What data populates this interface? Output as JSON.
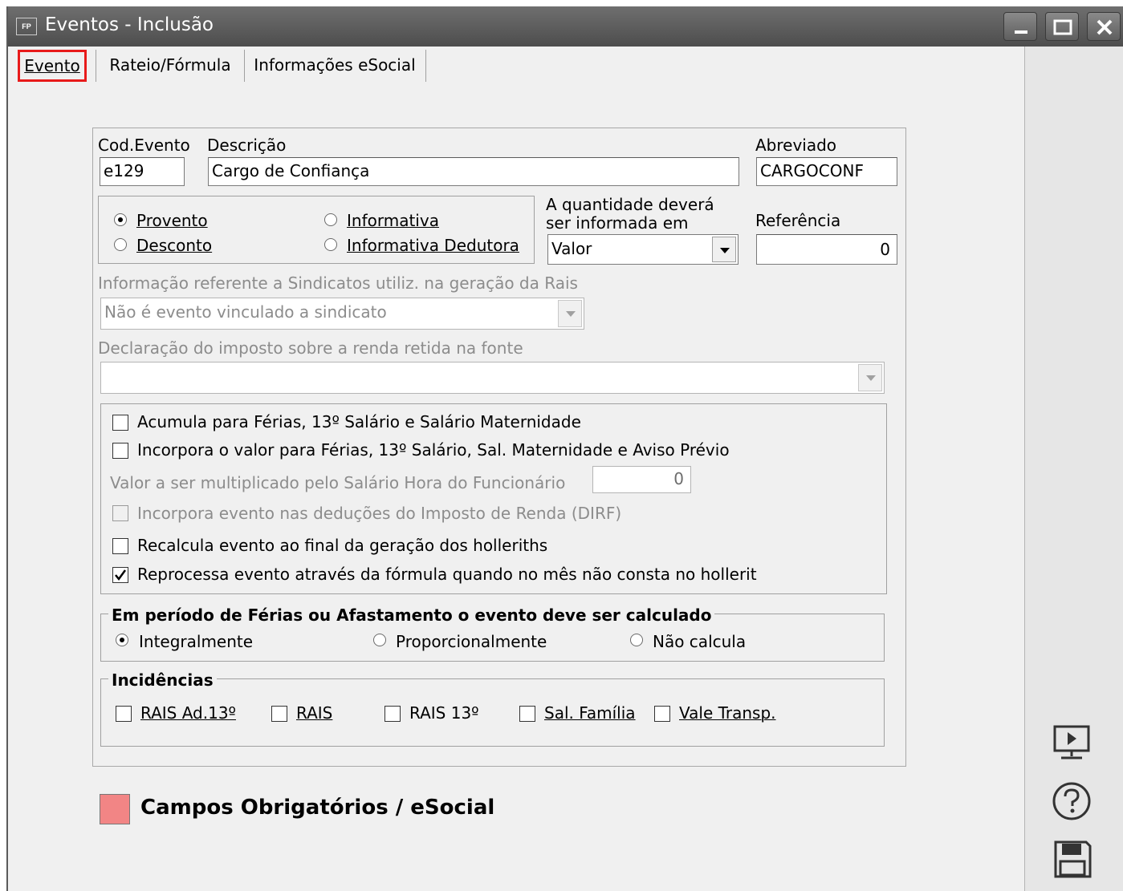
{
  "window": {
    "app_badge": "FP",
    "title": "Eventos - Inclusão"
  },
  "tabs": [
    "Evento",
    "Rateio/Fórmula",
    "Informações eSocial"
  ],
  "fields": {
    "cod_evento_label": "Cod.Evento",
    "cod_evento_value": "e129",
    "descricao_label": "Descrição",
    "descricao_value": "Cargo de Confiança",
    "abreviado_label": "Abreviado",
    "abreviado_value": "CARGOCONF"
  },
  "tipo": {
    "options": [
      "Provento",
      "Desconto",
      "Informativa",
      "Informativa Dedutora"
    ],
    "selected": "Provento"
  },
  "quantidade": {
    "label_line1": "A quantidade deverá",
    "label_line2": "ser informada em",
    "value": "Valor"
  },
  "referencia": {
    "label": "Referência",
    "value": "0"
  },
  "sindicatos": {
    "label": "Informação referente a Sindicatos utiliz. na geração da Rais",
    "value": "Não é evento vinculado a sindicato"
  },
  "dirf": {
    "label": "Declaração do imposto sobre a renda retida na fonte",
    "value": ""
  },
  "options": [
    {
      "label": "Acumula para Férias, 13º Salário e Salário Maternidade",
      "checked": false,
      "enabled": true
    },
    {
      "label": "Incorpora o valor para Férias, 13º Salário, Sal. Maternidade e Aviso Prévio",
      "checked": false,
      "enabled": true
    },
    {
      "label": "Incorpora evento nas deduções do Imposto de Renda (DIRF)",
      "checked": false,
      "enabled": false
    },
    {
      "label": "Recalcula evento ao final da geração dos holleriths",
      "checked": false,
      "enabled": true
    },
    {
      "label": "Reprocessa evento através da fórmula quando no mês não consta no hollerit",
      "checked": true,
      "enabled": true
    }
  ],
  "multiplicador": {
    "label": "Valor a ser multiplicado pelo Salário Hora do Funcionário",
    "value": "0"
  },
  "ferias": {
    "title": "Em período de Férias ou Afastamento o evento deve ser calculado",
    "options": [
      "Integralmente",
      "Proporcionalmente",
      "Não calcula"
    ],
    "selected": "Integralmente"
  },
  "incidencias": {
    "title": "Incidências",
    "items": [
      "RAIS Ad.13º",
      "RAIS",
      "RAIS 13º",
      "Sal. Família",
      "Vale Transp."
    ]
  },
  "legend": {
    "label": "Campos Obrigatórios / eSocial",
    "color": "#f28585"
  },
  "icons": [
    "presentation-icon",
    "help-icon",
    "save-icon"
  ]
}
